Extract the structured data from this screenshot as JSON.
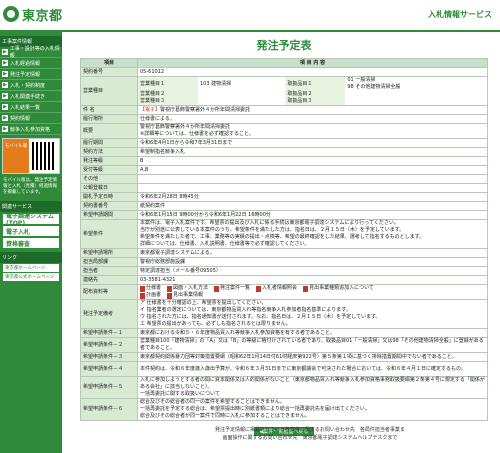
{
  "header": {
    "logo": "東京都",
    "service": "入札情報サービス"
  },
  "sidebar": {
    "section1": "工事案件情報",
    "items": [
      "工事・設計等の入札情報",
      "入札経過情報",
      "発注予定情報",
      "入札・契約制度",
      "入札関連手続き",
      "入札結果一覧",
      "契約情報",
      "競争入札参加資格"
    ],
    "mobile_label": "モバイル版",
    "mobile_note": "モバイル版は、発注予定情報と入札（見積）経過情報を掲載しています。",
    "section2": "関連サービス",
    "buttons": [
      "電子調達システム(TOP)",
      "電子入札",
      "資格審査"
    ],
    "section3": "リンク",
    "links": [
      "東京都ホームページ",
      "東京都公式ホームページ"
    ]
  },
  "main": {
    "title": "発注予定表",
    "head_item": "項目",
    "head_content": "項 目 内 容",
    "rows": {
      "contract_no_label": "契約番号",
      "contract_no": "05-61012",
      "business_label": "営業種目",
      "biz1_label": "営業種目１",
      "biz1": "103 建物清掃",
      "biz2_label": "営業種目２",
      "biz2": "",
      "biz3_label": "営業種目３",
      "biz3": "",
      "main1_label": "取扱品目１",
      "main1": "01 一般清掃",
      "main1b": "98 その他建物清掃全般",
      "main2_label": "取扱品目２",
      "main2": "",
      "main3_label": "取扱品目３",
      "main3": "",
      "name_label": "件 名",
      "name_tag": "【電子】",
      "name": "警視庁葛飾警察署外４か所年間清掃委託",
      "place_label": "履行場所",
      "place": "仕様書による。",
      "summary_label": "概要",
      "summary1": "警視庁葛飾警察署外４か所年間清掃委託",
      "summary2": "※詳細等については、仕様書を必ず確認すること。",
      "period_label": "履行期間",
      "period": "令和6年4月1日から令和7年3月31日まで",
      "method_label": "契約方法",
      "method": "希望制指名競争入札",
      "rank_label": "発注等級",
      "rank": "B",
      "accept_label": "受付等級",
      "accept": "A,B",
      "other_label": "その他",
      "other": "",
      "notice_label": "公報登載日",
      "notice": "",
      "open_label": "開札予定日時",
      "open": "令和6年2月28日 8時45分",
      "submit_label": "契約書番号",
      "submit": "紙契約案件",
      "app_label": "希望申請期間",
      "app": "令和6年1月15日 9時00分から令和6年1月22日 16時00分",
      "req_label": "希望条件",
      "req1": "本案件は、電子入札案件です。希望票の提出及び入札に係る手続は東京都電子調達システムにより行ってください。",
      "req2": "当庁が別途に公表している本案件のうち、希望条件を満たした方は、指名日は、２月１５日（木）を予定しています。",
      "req3": "希望条件を満たした者で、工事、業務等の実績の提出・点検等、希望の最終確認をした結果、選考して指名するものとします。",
      "req4": "詳細については、仕様書、入札説明書、仕様書等で必ず確認してください。",
      "system_label": "希望申請場所",
      "system": "東京都電子調達システムによる。",
      "dept_label": "担当局部課",
      "dept": "警視庁総務部施設課",
      "tel_label": "担当者",
      "tel": "特定調達担当（メール番号09505）",
      "phone_label": "連絡先",
      "phone": "03-3581-4321",
      "docs_label": "配布資料等",
      "docs": [
        "仕様書",
        "図面・入札方法",
        "発注案件一覧",
        "入札者情報照会",
        "計画書",
        "見出事業情報",
        "見出事業種類追加入について"
      ],
      "cond_label": "発注予定備考",
      "cond1": "ア 仕様書を十分確認の上、希望票を提出してください。",
      "cond2": "イ 指名業者の選定については、東京都物品買入れ等指名競争入札参加者指名基準によります。",
      "cond3": "ウ 指名された方には、指名通知書が送付されます。なお、指名日は、２月１５日（木）を予定しています。",
      "cond4": "エ 希望票の提出があっても、必ずしも指名されるとは限りません。",
      "w1_label": "希望申請条件－１",
      "w1": "東京都における令和５・６年度物品買入れ等競争入札参加資格を有する者であること。",
      "w2_label": "希望申請条件－２",
      "w2": "営業種目100「建物清掃」の「A」又は「B」の等級に格付けされている者であり、取扱品目01「一般清掃」又は98「その他建物清掃全般」に登録がある者であること。",
      "w3_label": "希望申請条件－３",
      "w3": "東京都契約関係暴力団等対策措置要綱（昭和62年1月14日付61財経庶第922号）第５条第１項に基づく排除措置期間中でない者であること。",
      "w4_label": "希望申請条件－４",
      "w4": "本件契約は、令和６年度歳入歳出予算が、令和６年３月31日までに東京都議会で可決された場合においては、令和６年４月１日に確定するもの。",
      "w5_label": "希望申請条件－５",
      "w5a": "入札に参加しようとする者の間に資本関係又は人的関係がないこと（東京都物品買入れ等競争入札参加資格事務取扱要綱第２条第４号に規定する「関係がある会社」に該当しないこと）。",
      "w5b": "一括再委託に関する取扱いについて",
      "w6_label": "希望申請条件－６",
      "w6a": "総合及びその総合者の同一の案件を希望することはできません。",
      "w6b": "一括再委託を予定する総合は、希望票提出時に別紙書類により総合一括再委託先を届け出てください。",
      "w6c": "総合及びその総合者が同一案件で同時に入札に参加することはできません。"
    },
    "back_button": "案件一覧画面へ戻る"
  },
  "footer": {
    "line1a": "発注予定情報に掲載されている各案件に関するお問い合わせ先",
    "line1b": "各局件担当者事業ま",
    "line2a": "画面操作に関するお問い合わせ先",
    "line2b": "東京都電子調達システムヘルプデスクまで"
  }
}
